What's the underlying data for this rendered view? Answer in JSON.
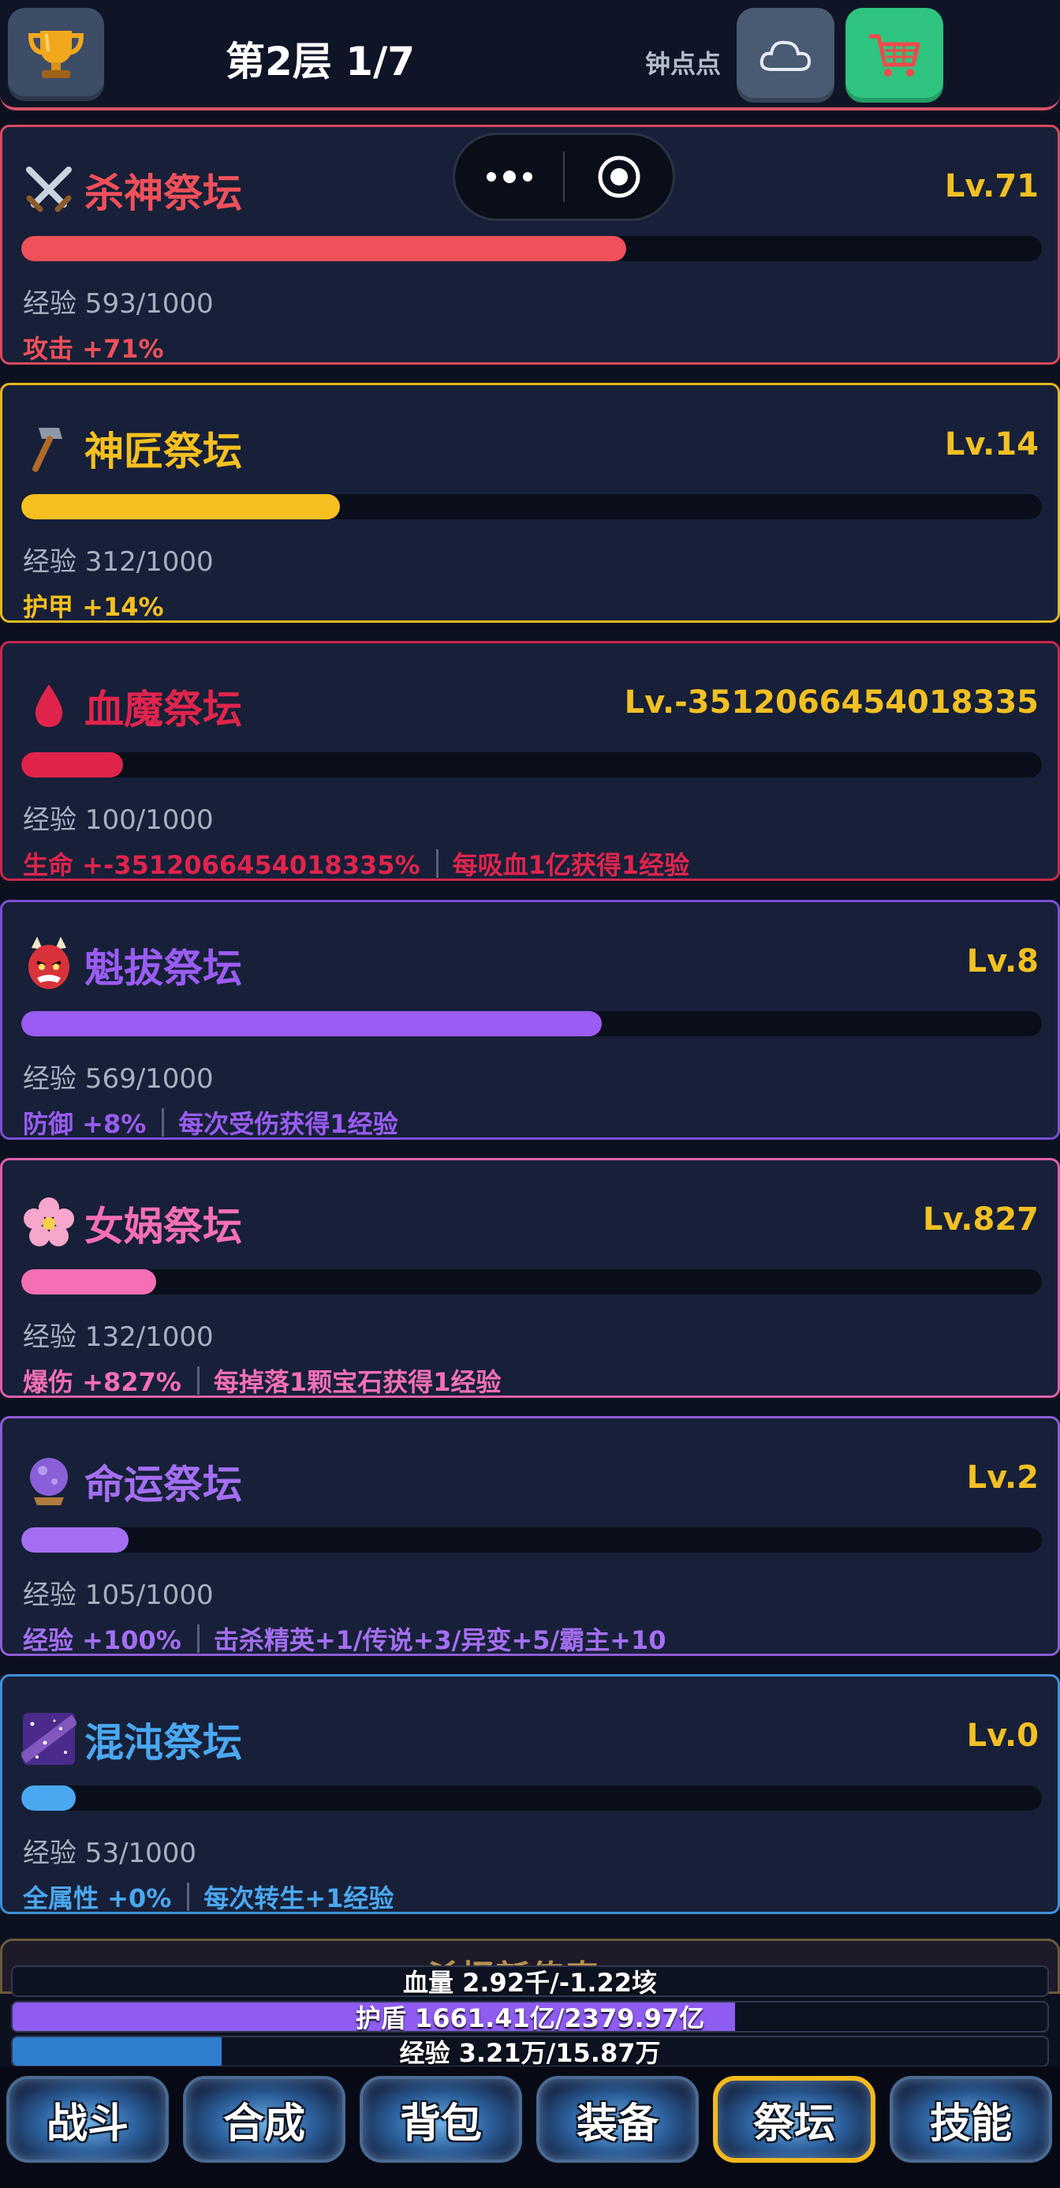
{
  "header": {
    "floor_title": "第2层 1/7",
    "sync_label": "钟点点"
  },
  "altars": [
    {
      "icon": "crossed-swords-icon",
      "name": "杀神祭坛",
      "level": "Lv.71",
      "exp": "经验 593/1000",
      "progress": 0.593,
      "color": "#f0505a",
      "effect": "攻击 +71%",
      "extra": ""
    },
    {
      "icon": "hammer-icon",
      "name": "神匠祭坛",
      "level": "Lv.14",
      "exp": "经验 312/1000",
      "progress": 0.312,
      "color": "#f5c01f",
      "effect": "护甲 +14%",
      "extra": ""
    },
    {
      "icon": "blood-drop-icon",
      "name": "血魔祭坛",
      "level": "Lv.-3512066454018335",
      "exp": "经验 100/1000",
      "progress": 0.1,
      "color": "#e0244c",
      "effect": "生命 +-3512066454018335%",
      "extra": "每吸血1亿获得1经验"
    },
    {
      "icon": "oni-mask-icon",
      "name": "魁拔祭坛",
      "level": "Lv.8",
      "exp": "经验 569/1000",
      "progress": 0.569,
      "color": "#9a5cf2",
      "effect": "防御 +8%",
      "extra": "每次受伤获得1经验"
    },
    {
      "icon": "cherry-blossom-icon",
      "name": "女娲祭坛",
      "level": "Lv.827",
      "exp": "经验 132/1000",
      "progress": 0.132,
      "color": "#f56fb4",
      "effect": "爆伤 +827%",
      "extra": "每掉落1颗宝石获得1经验"
    },
    {
      "icon": "crystal-ball-icon",
      "name": "命运祭坛",
      "level": "Lv.2",
      "exp": "经验 105/1000",
      "progress": 0.105,
      "color": "#a46ef2",
      "effect": "经验 +100%",
      "extra": "击杀精英+1/传说+3/异变+5/霸主+10"
    },
    {
      "icon": "galaxy-icon",
      "name": "混沌祭坛",
      "level": "Lv.0",
      "exp": "经验 53/1000",
      "progress": 0.053,
      "color": "#4aa8f0",
      "effect": "全属性 +0%",
      "extra": "每次转生+1经验"
    }
  ],
  "banner": {
    "text": "杀怪新传奇"
  },
  "stats": {
    "hp": {
      "text": "血量 2.92千/-1.22垓",
      "progress": 0.0,
      "color": "#c93a3a"
    },
    "shield": {
      "text": "护盾 1661.41亿/2379.97亿",
      "progress": 0.698,
      "color": "#8e5cf0"
    },
    "exp": {
      "text": "经验 3.21万/15.87万",
      "progress": 0.202,
      "color": "#2f7fd0"
    }
  },
  "nav": {
    "items": [
      {
        "label": "战斗",
        "active": false
      },
      {
        "label": "合成",
        "active": false
      },
      {
        "label": "背包",
        "active": false
      },
      {
        "label": "装备",
        "active": false
      },
      {
        "label": "祭坛",
        "active": true
      },
      {
        "label": "技能",
        "active": false
      }
    ]
  }
}
